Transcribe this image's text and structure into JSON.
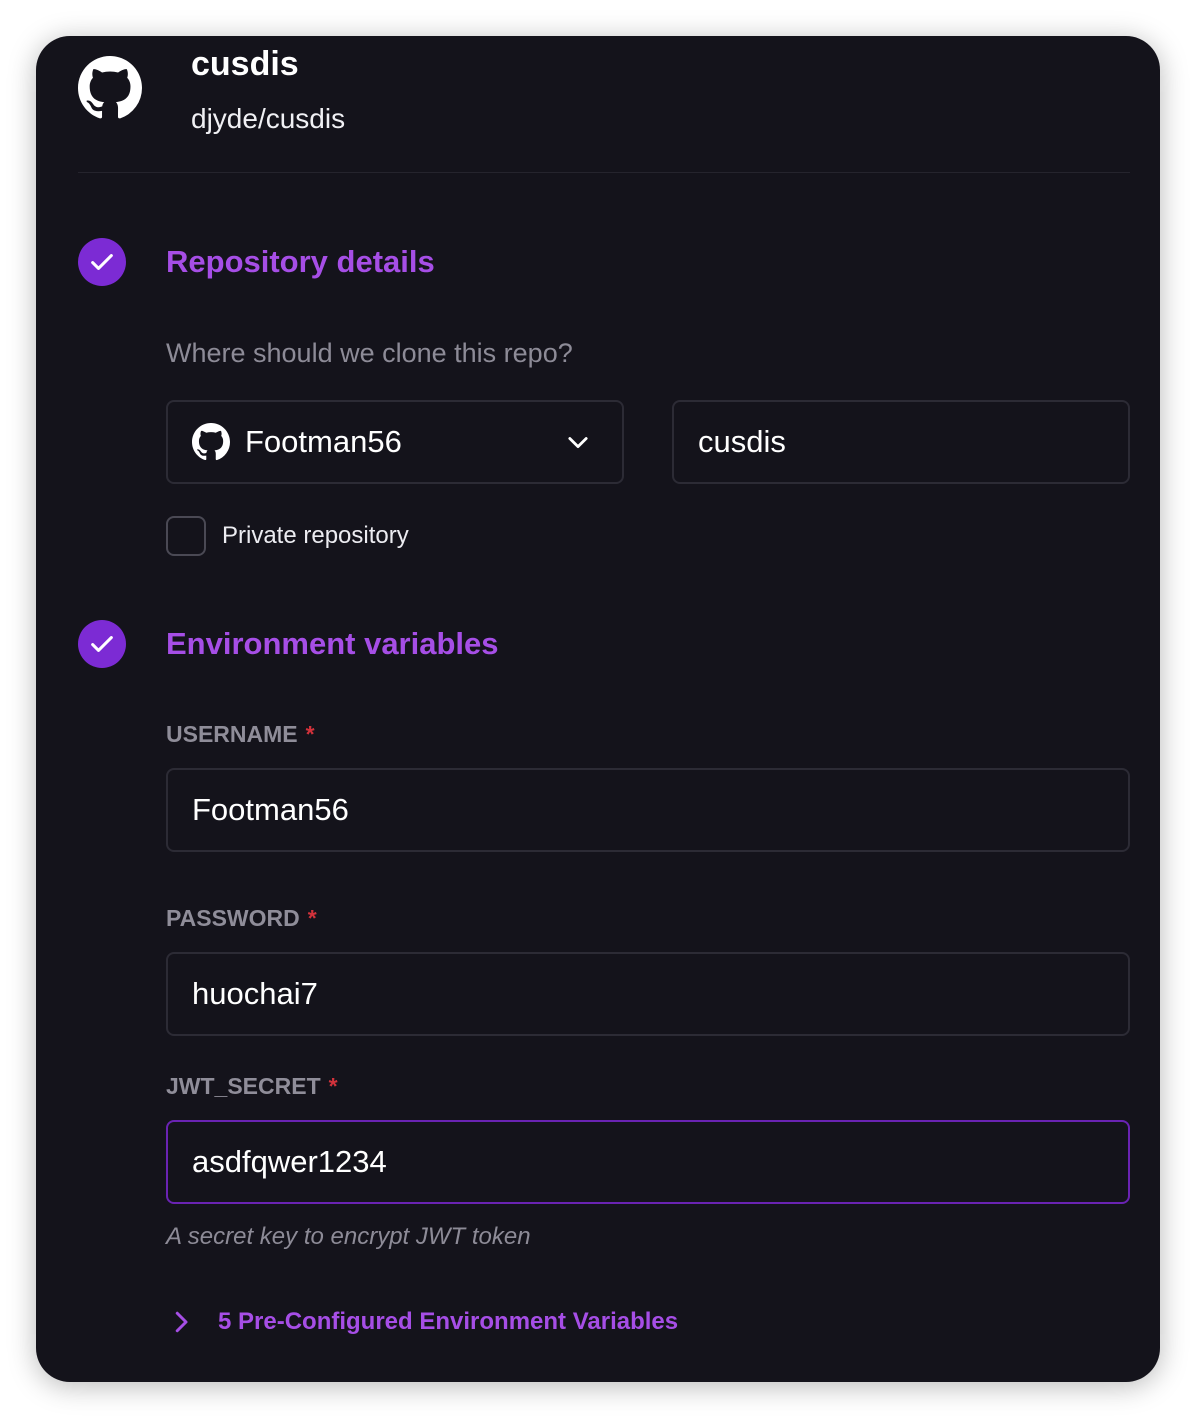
{
  "header": {
    "repo_name": "cusdis",
    "repo_path": "djyde/cusdis",
    "logo_icon": "github-icon"
  },
  "repository_details": {
    "title": "Repository details",
    "question": "Where should we clone this repo?",
    "owner_select": {
      "icon": "github-icon",
      "selected": "Footman56"
    },
    "repo_name_input": {
      "value": "cusdis"
    },
    "private_checkbox": {
      "label": "Private repository",
      "checked": false
    }
  },
  "environment_variables": {
    "title": "Environment variables",
    "required_marker": "*",
    "fields": [
      {
        "key": "USERNAME",
        "value": "Footman56"
      },
      {
        "key": "PASSWORD",
        "value": "huochai7"
      },
      {
        "key": "JWT_SECRET",
        "value": "asdfqwer1234",
        "hint": "A secret key to encrypt JWT token"
      }
    ],
    "preconfigured_toggle": "5 Pre-Configured Environment Variables"
  },
  "colors": {
    "background": "#14131b",
    "accent": "#a64ee6",
    "check_circle": "#7c2bd4",
    "required": "#d2323b",
    "focus_border": "#6a23b3"
  }
}
